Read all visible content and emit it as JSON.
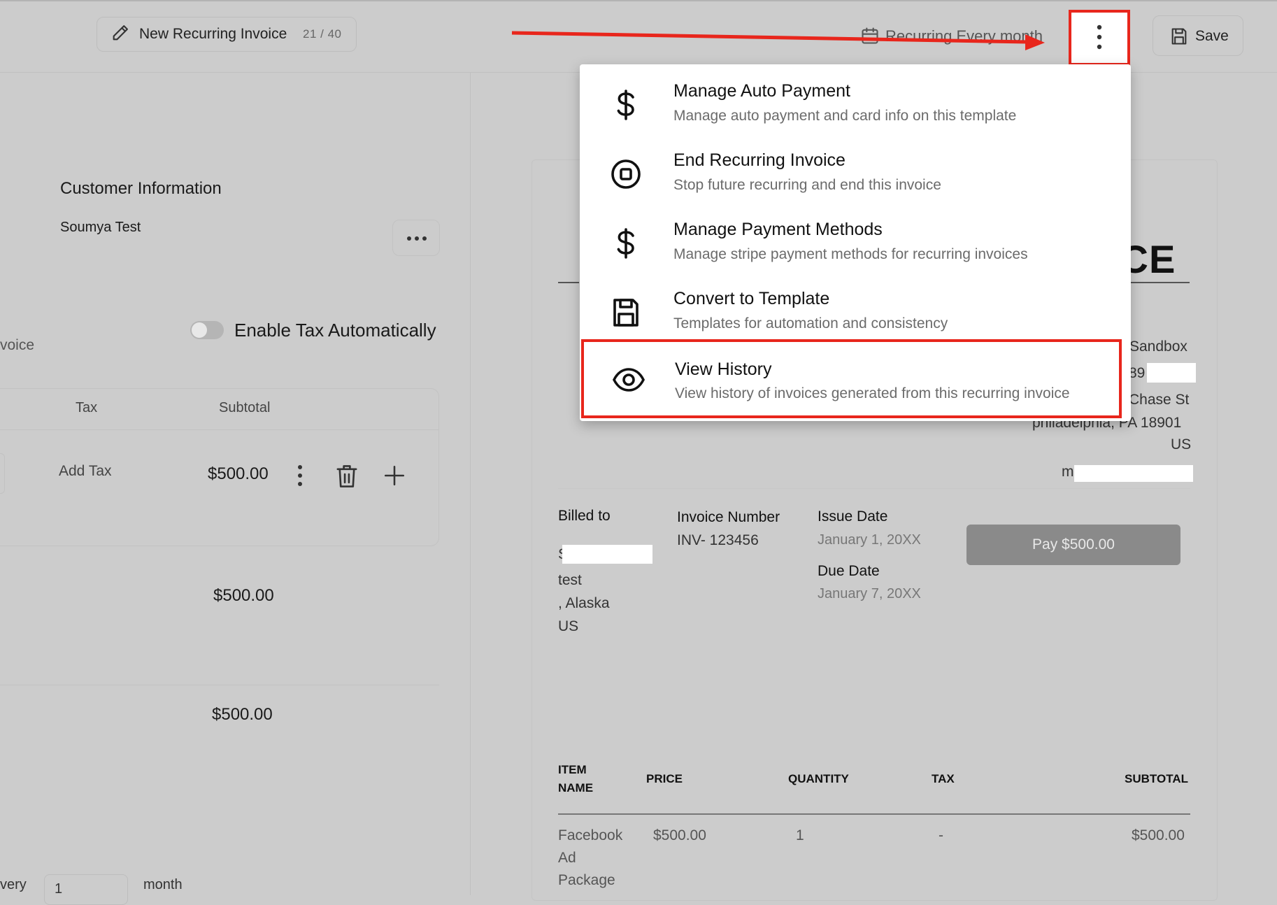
{
  "header": {
    "title": "New Recurring Invoice",
    "title_count": "21 / 40",
    "recurring_label": "Recurring Every month",
    "save_label": "Save"
  },
  "customer": {
    "section_title": "Customer Information",
    "name": "Soumya Test"
  },
  "tax": {
    "toggle_label": "Enable Tax Automatically",
    "partial_label": "voice"
  },
  "line_table": {
    "headers": {
      "tax": "Tax",
      "subtotal": "Subtotal"
    },
    "row": {
      "tax_action": "Add Tax",
      "amount": "$500.00"
    }
  },
  "summary": {
    "amount_1": "$500.00",
    "amount_2": "$500.00"
  },
  "schedule": {
    "every_partial": "very",
    "interval_value": "1",
    "interval_unit": "month"
  },
  "preview": {
    "heading_partial": "ICE",
    "org": {
      "name_partial": "Sandbox",
      "phone_partial": "89",
      "street_partial": "Chase St",
      "city": "philadelphia, PA 18901",
      "country": "US",
      "email_partial": "m"
    },
    "billed_to": {
      "label": "Billed to",
      "line1_partial": "S",
      "line2": "test",
      "line3": ", Alaska",
      "line4": "US"
    },
    "invoice_number": {
      "label": "Invoice Number",
      "value": "INV- 123456"
    },
    "issue_date": {
      "label": "Issue Date",
      "value": "January 1, 20XX"
    },
    "due_date": {
      "label": "Due Date",
      "value": "January 7, 20XX"
    },
    "pay_button": "Pay $500.00",
    "items": {
      "headers": {
        "name_1": "ITEM",
        "name_2": "NAME",
        "price": "PRICE",
        "quantity": "QUANTITY",
        "tax": "TAX",
        "subtotal": "SUBTOTAL"
      },
      "rows": [
        {
          "name_1": "Facebook",
          "name_2": "Ad",
          "name_3": "Package",
          "price": "$500.00",
          "quantity": "1",
          "tax": "-",
          "subtotal": "$500.00"
        }
      ]
    }
  },
  "menu": {
    "items": [
      {
        "title": "Manage Auto Payment",
        "desc": "Manage auto payment and card info on this template",
        "icon": "dollar-icon"
      },
      {
        "title": "End Recurring Invoice",
        "desc": "Stop future recurring and end this invoice",
        "icon": "stop-circle-icon"
      },
      {
        "title": "Manage Payment Methods",
        "desc": "Manage stripe payment methods for recurring invoices",
        "icon": "dollar-icon"
      },
      {
        "title": "Convert to Template",
        "desc": "Templates for automation and consistency",
        "icon": "floppy-disk-icon"
      },
      {
        "title": "View History",
        "desc": "View history of invoices generated from this recurring invoice",
        "icon": "eye-icon"
      }
    ]
  },
  "colors": {
    "highlight": "#e8261c",
    "overlay_bg": "#cccccc",
    "menu_bg": "#ffffff",
    "pay_button": "#8a8a8a"
  }
}
